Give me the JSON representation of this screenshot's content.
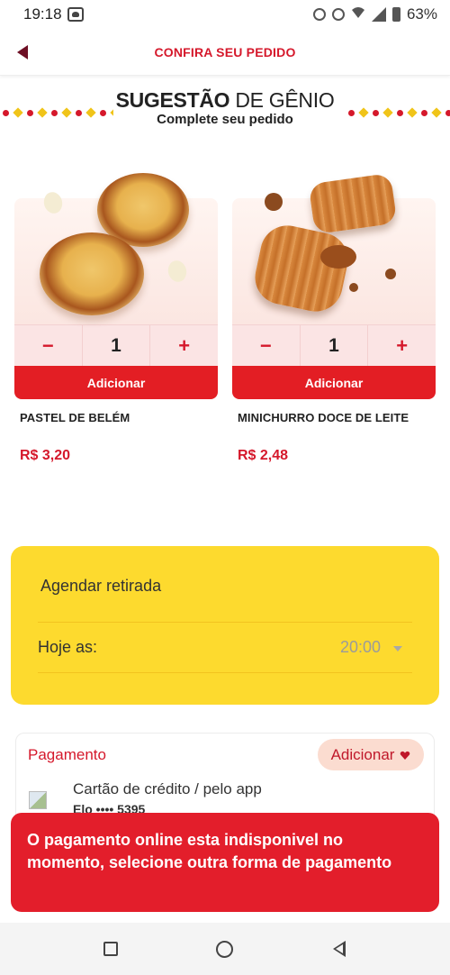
{
  "status_bar": {
    "time": "19:18",
    "battery": "63%",
    "icons": [
      "alarm-icon",
      "dnd-icon",
      "wifi-icon",
      "signal-icon",
      "battery-icon"
    ]
  },
  "header": {
    "title": "CONFIRA SEU PEDIDO",
    "back_icon": "back-arrow-icon"
  },
  "suggestion": {
    "title_bold": "SUGESTÃO",
    "title_rest": "DE GÊNIO",
    "subtitle": "Complete seu pedido"
  },
  "products": [
    {
      "name": "PASTEL DE BELÉM",
      "price": "R$ 3,20",
      "quantity": "1",
      "add_label": "Adicionar",
      "minus": "−",
      "plus": "+"
    },
    {
      "name": "MINICHURRO DOCE DE LEITE",
      "price": "R$ 2,48",
      "quantity": "1",
      "add_label": "Adicionar",
      "minus": "−",
      "plus": "+"
    }
  ],
  "schedule": {
    "title": "Agendar retirada",
    "today_label": "Hoje as:",
    "time": "20:00"
  },
  "payment": {
    "title": "Pagamento",
    "add_label": "Adicionar",
    "method": "Cartão de crédito / pelo app",
    "card": "Elo •••• 5395"
  },
  "toast": {
    "message": "O pagamento online esta indisponivel no momento, selecione outra forma de pagamento"
  },
  "colors": {
    "brand_red": "#e31e24",
    "accent_yellow": "#fdda2e",
    "pink_bg": "#fbe4e4"
  }
}
